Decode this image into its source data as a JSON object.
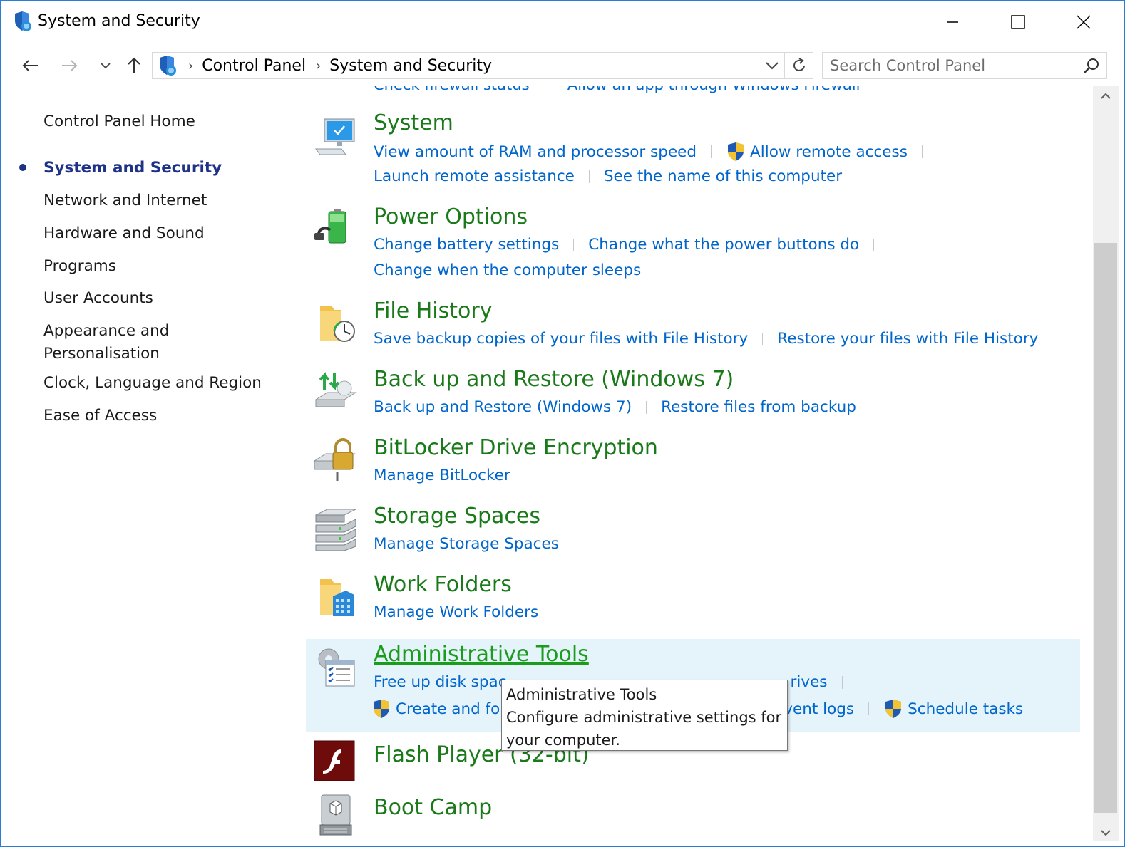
{
  "window": {
    "title": "System and Security",
    "icon": "shield-security-icon"
  },
  "navigation": {
    "back_icon": "arrow-left-icon",
    "forward_icon": "arrow-right-icon",
    "recent_icon": "chevron-down-icon",
    "up_icon": "arrow-up-icon",
    "breadcrumbs": [
      "Control Panel",
      "System and Security"
    ],
    "refresh_icon": "refresh-icon",
    "search_placeholder": "Search Control Panel"
  },
  "sidebar": {
    "home": "Control Panel Home",
    "items": [
      {
        "label": "System and Security",
        "current": true
      },
      {
        "label": "Network and Internet"
      },
      {
        "label": "Hardware and Sound"
      },
      {
        "label": "Programs"
      },
      {
        "label": "User Accounts"
      },
      {
        "label": "Appearance and Personalisation",
        "lines": [
          "Appearance and",
          "Personalisation"
        ]
      },
      {
        "label": "Clock, Language and Region"
      },
      {
        "label": "Ease of Access"
      }
    ]
  },
  "content": {
    "partial_row": [
      "Check firewall status",
      "Allow an app through Windows Firewall"
    ],
    "categories": [
      {
        "title": "System",
        "icon": "computer-monitor-icon",
        "links": [
          [
            "View amount of RAM and processor speed",
            "Allow remote access"
          ],
          [
            "Launch remote assistance",
            "See the name of this computer"
          ]
        ]
      },
      {
        "title": "Power Options",
        "icon": "battery-plug-icon",
        "links": [
          [
            "Change battery settings",
            "Change what the power buttons do"
          ],
          [
            "Change when the computer sleeps"
          ]
        ]
      },
      {
        "title": "File History",
        "icon": "folder-clock-icon",
        "links": [
          [
            "Save backup copies of your files with File History",
            "Restore your files with File History"
          ]
        ]
      },
      {
        "title": "Back up and Restore (Windows 7)",
        "icon": "backup-drive-icon",
        "links": [
          [
            "Back up and Restore (Windows 7)",
            "Restore files from backup"
          ]
        ]
      },
      {
        "title": "BitLocker Drive Encryption",
        "icon": "drive-lock-icon",
        "links": [
          [
            "Manage BitLocker"
          ]
        ]
      },
      {
        "title": "Storage Spaces",
        "icon": "stacked-drives-icon",
        "links": [
          [
            "Manage Storage Spaces"
          ]
        ]
      },
      {
        "title": "Work Folders",
        "icon": "folder-building-icon",
        "links": [
          [
            "Manage Work Folders"
          ]
        ]
      },
      {
        "title": "Administrative Tools",
        "icon": "gear-checklist-icon",
        "links": [
          [
            "Free up disk spac",
            "rives"
          ],
          [
            "Create and fo",
            "vent logs",
            "Schedule tasks"
          ]
        ]
      },
      {
        "title": "Flash Player (32-bit)",
        "icon": "flash-player-icon",
        "links": []
      },
      {
        "title": "Boot Camp",
        "icon": "boot-camp-drive-icon",
        "links": []
      }
    ]
  },
  "tooltip": {
    "title": "Administrative Tools",
    "body_line1": "Configure administrative settings for",
    "body_line2": "your computer."
  },
  "colors": {
    "category_title": "#1a7a1a",
    "link": "#0066cc",
    "hover_background": "#e5f3fb",
    "current_nav": "#1e3287",
    "window_border": "#2b7cd3"
  }
}
